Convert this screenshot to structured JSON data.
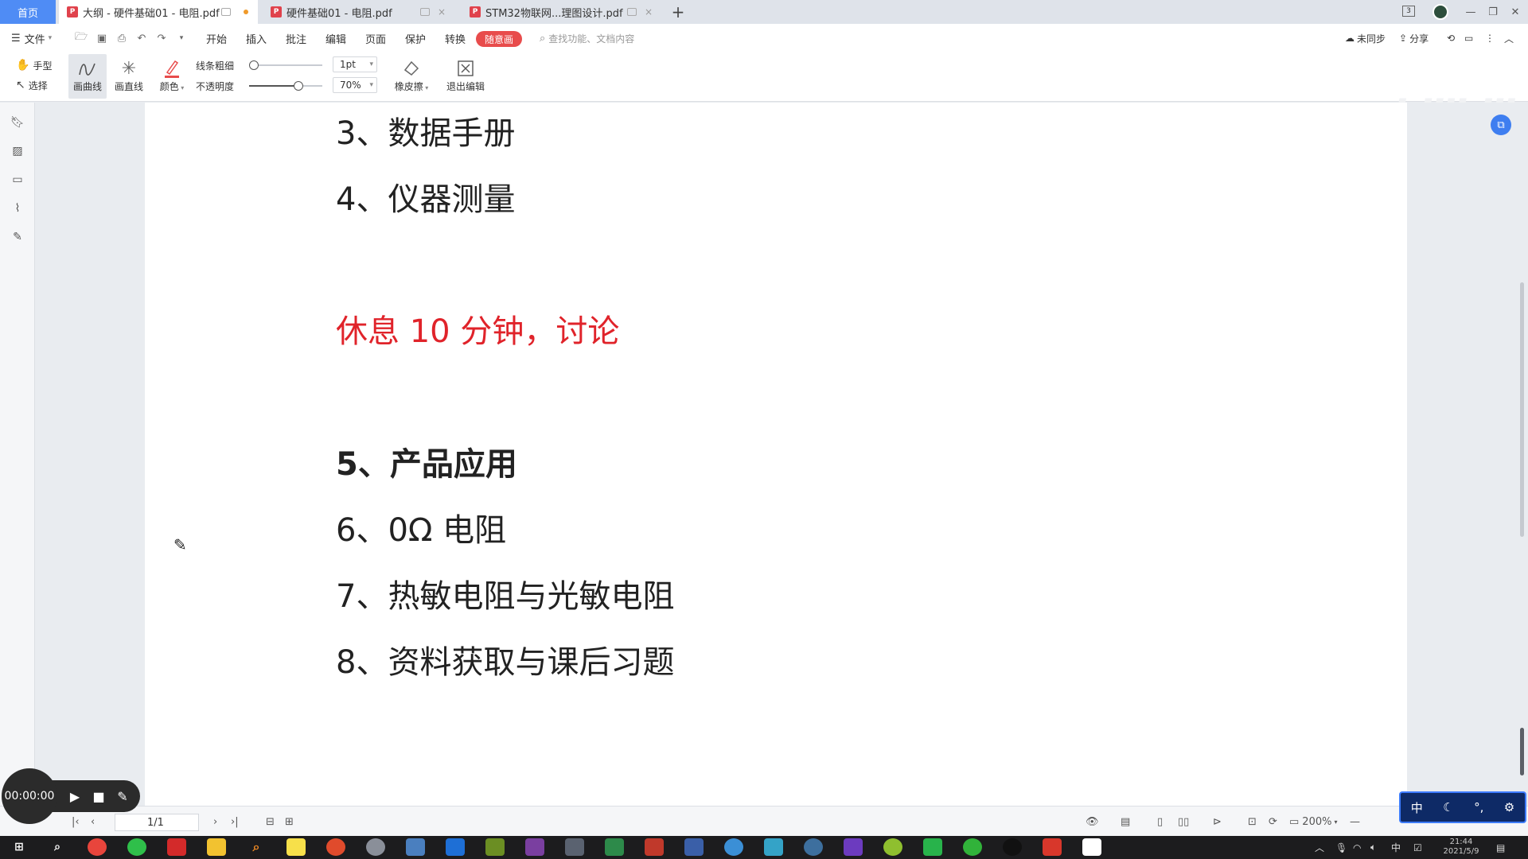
{
  "tabs": {
    "home": "首页",
    "items": [
      {
        "label": "大纲 - 硬件基础01 - 电阻.pdf",
        "active": true
      },
      {
        "label": "硬件基础01 - 电阻.pdf",
        "active": false
      },
      {
        "label": "STM32物联网...理图设计.pdf",
        "active": false
      }
    ],
    "add": "+"
  },
  "menu": {
    "file": "文件",
    "items": [
      "开始",
      "插入",
      "批注",
      "编辑",
      "页面",
      "保护",
      "转换"
    ],
    "draw": "随意画",
    "search_placeholder": "查找功能、文档内容",
    "sync": "未同步",
    "share": "分享"
  },
  "ink_toolbar": {
    "hand": "手型",
    "select": "选择",
    "draw_curve": "画曲线",
    "draw_line": "画直线",
    "color": "颜色",
    "line_width_label": "线条粗细",
    "opacity_label": "不透明度",
    "line_width_value": "1pt",
    "opacity_value": "70%",
    "eraser": "橡皮擦",
    "exit_edit": "退出编辑",
    "opacity_level": 0.7,
    "line_width_level": 0.0
  },
  "watermark": "bilibili",
  "document": {
    "lines": [
      {
        "text": "3、数据手册",
        "style": "normal"
      },
      {
        "text": "4、仪器测量",
        "style": "normal"
      },
      {
        "text": "休息 10 分钟，讨论",
        "style": "red"
      },
      {
        "text": "5、产品应用",
        "style": "bold"
      },
      {
        "text": "6、0Ω 电阻",
        "style": "normal"
      },
      {
        "text": "7、热敏电阻与光敏电阻",
        "style": "normal"
      },
      {
        "text": "8、资料获取与课后习题",
        "style": "normal"
      }
    ]
  },
  "status": {
    "page": "1/1",
    "zoom": "200%"
  },
  "recorder": {
    "time": "00:00:00"
  },
  "ime": {
    "lang": "中"
  },
  "taskbar": {
    "tray_lang": "中",
    "time": "21:44",
    "date": "2021/5/9"
  },
  "colors": {
    "accent": "#4f8cf5",
    "draw_button": "#e84c4c",
    "red_text": "#e0232a"
  }
}
